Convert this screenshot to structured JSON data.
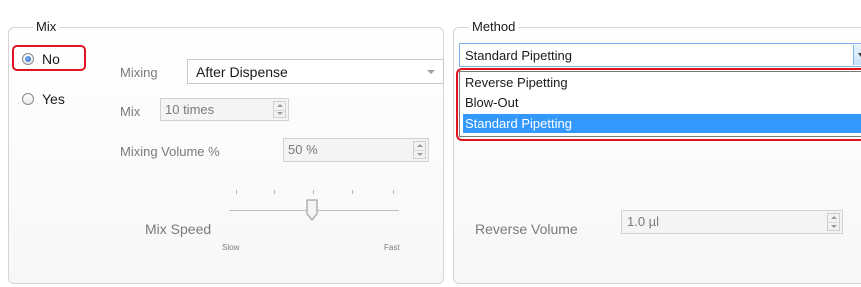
{
  "mix": {
    "group_title": "Mix",
    "options": [
      {
        "label": "No",
        "selected": true
      },
      {
        "label": "Yes",
        "selected": false
      }
    ],
    "mixing_label": "Mixing",
    "mixing_value": "After Dispense",
    "mix_label": "Mix",
    "mix_value": "10 times",
    "volume_label": "Mixing Volume %",
    "volume_value": "50 %",
    "speed_label": "Mix Speed",
    "speed_slow": "Slow",
    "speed_fast": "Fast"
  },
  "method": {
    "group_title": "Method",
    "selected_value": "Standard Pipetting",
    "options": [
      "Reverse Pipetting",
      "Blow-Out",
      "Standard Pipetting"
    ],
    "highlighted_option_index": 2,
    "reverse_volume_label": "Reverse Volume",
    "reverse_volume_value": "1.0 µl"
  },
  "colors": {
    "highlight_border": "#e0141e",
    "selection_blue": "#3399ff",
    "radio_dot": "#1f5fbf"
  }
}
